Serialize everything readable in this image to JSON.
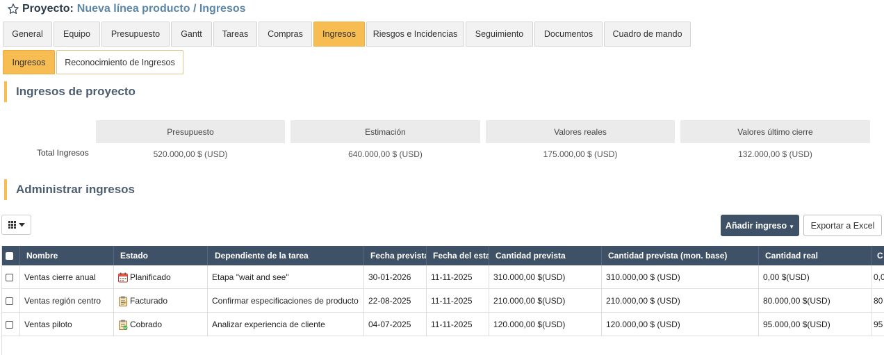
{
  "header": {
    "label": "Proyecto:",
    "path": "Nueva línea producto / Ingresos",
    "star_icon": "star-outline-icon"
  },
  "main_tabs": [
    {
      "label": "General",
      "active": false
    },
    {
      "label": "Equipo",
      "active": false
    },
    {
      "label": "Presupuesto",
      "active": false
    },
    {
      "label": "Gantt",
      "active": false
    },
    {
      "label": "Tareas",
      "active": false
    },
    {
      "label": "Compras",
      "active": false
    },
    {
      "label": "Ingresos",
      "active": true
    },
    {
      "label": "Riesgos e Incidencias",
      "active": false
    },
    {
      "label": "Seguimiento",
      "active": false
    },
    {
      "label": "Documentos",
      "active": false
    },
    {
      "label": "Cuadro de mando",
      "active": false
    }
  ],
  "sub_tabs": [
    {
      "label": "Ingresos",
      "active": true
    },
    {
      "label": "Reconocimiento de Ingresos",
      "active": false
    }
  ],
  "sections": {
    "summary_title": "Ingresos de proyecto",
    "manage_title": "Administrar ingresos"
  },
  "summary": {
    "row_label": "Total Ingresos",
    "columns": [
      {
        "header": "Presupuesto",
        "value": "520.000,00 $ (USD)"
      },
      {
        "header": "Estimación",
        "value": "640.000,00 $ (USD)"
      },
      {
        "header": "Valores reales",
        "value": "175.000,00 $ (USD)"
      },
      {
        "header": "Valores último cierre",
        "value": "132.000,00 $ (USD)"
      }
    ]
  },
  "toolbar": {
    "add_label": "Añadir ingreso",
    "export_label": "Exportar a Excel",
    "grid_icon": "grid-icon"
  },
  "table": {
    "headers": [
      "Nombre",
      "Estado",
      "Dependiente de la tarea",
      "Fecha prevista",
      "Fecha del estado",
      "Cantidad prevista",
      "Cantidad prevista (mon. base)",
      "Cantidad real",
      "C"
    ],
    "rows": [
      {
        "nombre": "Ventas cierre anual",
        "estado": "Planificado",
        "estado_icon": "calendar-icon",
        "tarea": "Etapa \"wait and see\"",
        "fecha_prevista": "30-01-2026",
        "fecha_estado": "11-11-2025",
        "cantidad_prevista": "310.000,00 $(USD)",
        "cantidad_base": "310.000,00 $ (USD)",
        "cantidad_real": "0,00 $(USD)",
        "extra": "0,0"
      },
      {
        "nombre": "Ventas región centro",
        "estado": "Facturado",
        "estado_icon": "clipboard-icon",
        "tarea": "Confirmar especificaciones de producto",
        "fecha_prevista": "22-08-2025",
        "fecha_estado": "11-11-2025",
        "cantidad_prevista": "210.000,00 $(USD)",
        "cantidad_base": "210.000,00 $ (USD)",
        "cantidad_real": "80.000,00 $(USD)",
        "extra": "80"
      },
      {
        "nombre": "Ventas piloto",
        "estado": "Cobrado",
        "estado_icon": "clipboard-check-icon",
        "tarea": "Analizar experiencia de cliente",
        "fecha_prevista": "04-07-2025",
        "fecha_estado": "11-11-2025",
        "cantidad_prevista": "120.000,00 $(USD)",
        "cantidad_base": "120.000,00 $ (USD)",
        "cantidad_real": "95.000,00 $(USD)",
        "extra": "95"
      }
    ]
  },
  "colors": {
    "accent": "#f7bd52",
    "header_bg": "#3f5166",
    "title_link": "#5b87a8"
  }
}
